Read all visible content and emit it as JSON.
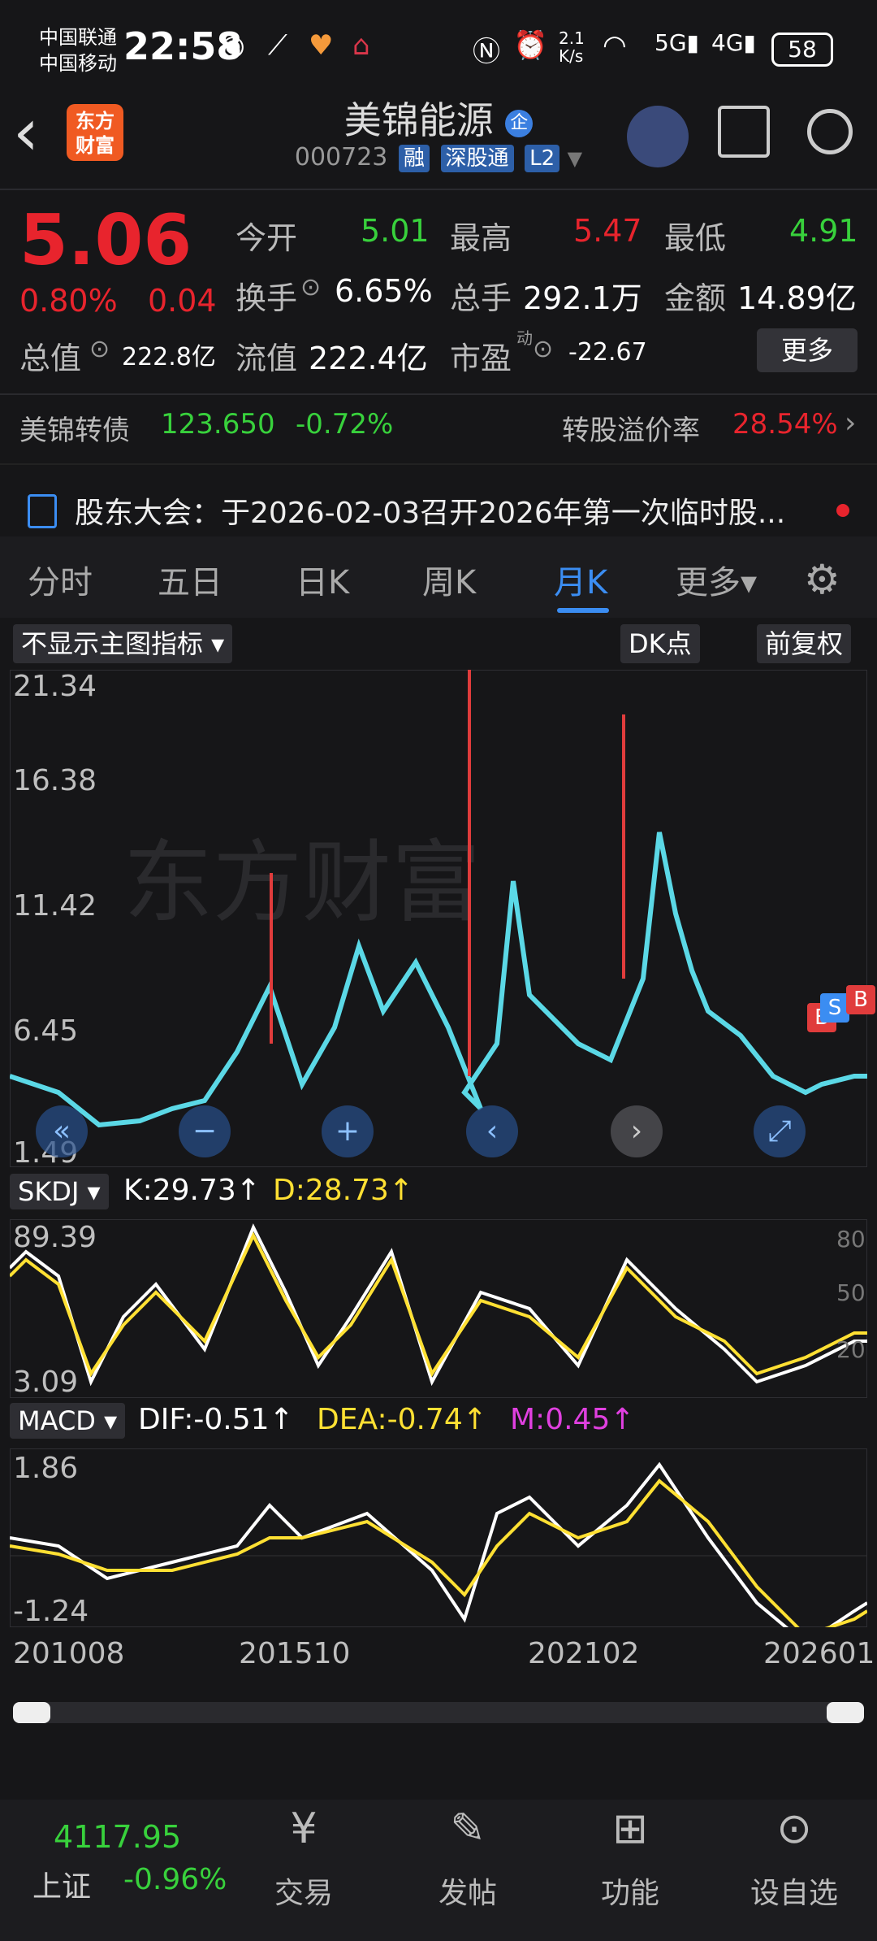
{
  "status": {
    "carrier1": "中国联通",
    "carrier2": "中国移动",
    "time": "22:58",
    "speed": "2.1\nK/s",
    "battery": "58"
  },
  "header": {
    "back": "‹",
    "logo_line1": "东方",
    "logo_line2": "财富",
    "title": "美锦能源",
    "title_badge": "企",
    "code": "000723",
    "tags": [
      "融",
      "深股通",
      "L2"
    ]
  },
  "quote": {
    "price": "5.06",
    "pct": "0.80%",
    "chg": "0.04",
    "open_label": "今开",
    "open": "5.01",
    "high_label": "最高",
    "high": "5.47",
    "low_label": "最低",
    "low": "4.91",
    "turnover_label": "换手",
    "turnover": "6.65%",
    "volume_label": "总手",
    "volume": "292.1万",
    "amount_label": "金额",
    "amount": "14.89亿",
    "mcap_label": "总值",
    "mcap": "222.8亿",
    "fcap_label": "流值",
    "fcap": "222.4亿",
    "pe_label": "市盈",
    "pe_sup": "动",
    "pe": "-22.67",
    "more": "更多"
  },
  "bond": {
    "label": "美锦转债",
    "price": "123.650",
    "pct": "-0.72%",
    "premium_label": "转股溢价率",
    "premium": "28.54%"
  },
  "notice": {
    "text": "股东大会：于2026-02-03召开2026年第一次临时股..."
  },
  "tabs": [
    "分时",
    "五日",
    "日K",
    "周K",
    "月K",
    "更多▾"
  ],
  "chart_controls": {
    "indicator": "不显示主图指标 ▾",
    "dk": "DK点",
    "adjust": "前复权"
  },
  "kline": {
    "y_ticks": [
      "21.34",
      "16.38",
      "11.42",
      "6.45",
      "1.49"
    ],
    "markers": [
      "B",
      "S",
      "B"
    ]
  },
  "skdj": {
    "label": "SKDJ ▾",
    "k": "K:29.73↑",
    "d": "D:28.73↑",
    "y_top": "89.39",
    "y_bottom": "3.09",
    "r80": "80",
    "r50": "50",
    "r20": "20"
  },
  "macd": {
    "label": "MACD ▾",
    "dif": "DIF:-0.51↑",
    "dea": "DEA:-0.74↑",
    "m": "M:0.45↑",
    "y_top": "1.86",
    "y_bottom": "-1.24"
  },
  "x_ticks": [
    "201008",
    "201510",
    "202102",
    "202601"
  ],
  "bottom": {
    "index_value": "4117.95",
    "index_name": "上证",
    "index_pct": "-0.96%",
    "nav": [
      "交易",
      "发帖",
      "功能",
      "设自选"
    ]
  }
}
